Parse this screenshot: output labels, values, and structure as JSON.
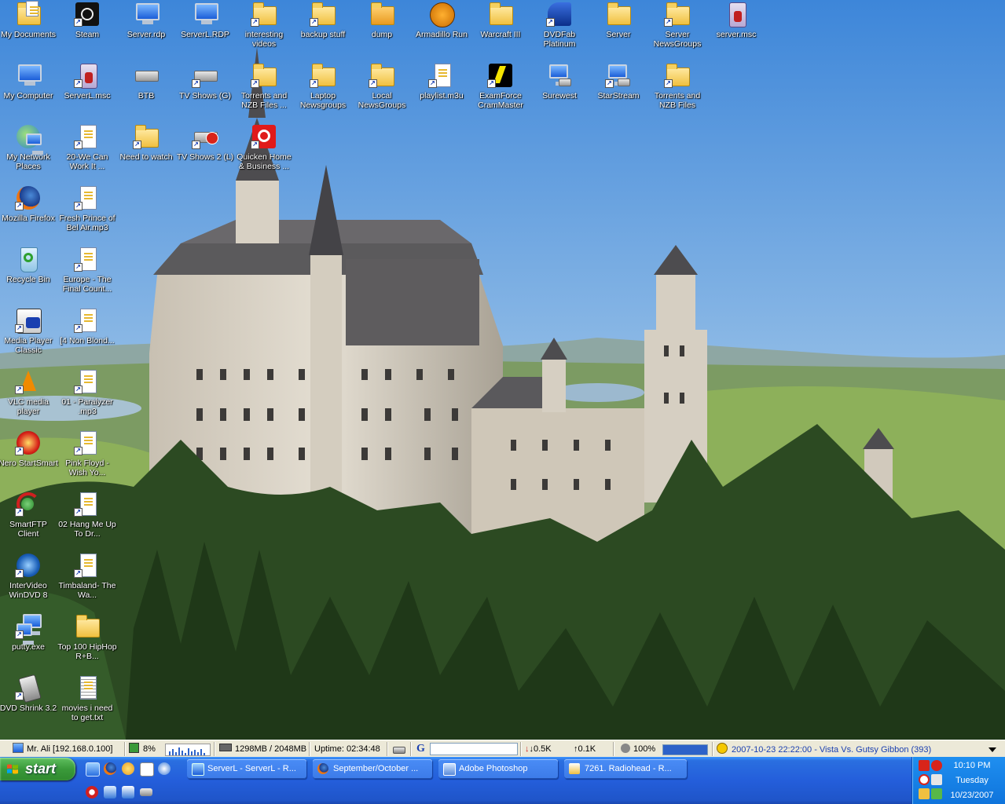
{
  "desktop": {
    "icons": [
      {
        "label": "My Documents",
        "icon": "my-documents-icon"
      },
      {
        "label": "Steam",
        "icon": "steam-icon"
      },
      {
        "label": "Server.rdp",
        "icon": "remote-desktop-icon"
      },
      {
        "label": "ServerL.RDP",
        "icon": "remote-desktop-icon"
      },
      {
        "label": "interesting videos",
        "icon": "folder-icon"
      },
      {
        "label": "backup stuff",
        "icon": "folder-icon"
      },
      {
        "label": "dump",
        "icon": "folder-icon"
      },
      {
        "label": "Armadillo Run",
        "icon": "armadillo-run-icon"
      },
      {
        "label": "Warcraft III",
        "icon": "folder-icon"
      },
      {
        "label": "DVDFab Platinum",
        "icon": "dvdfab-icon"
      },
      {
        "label": "Server",
        "icon": "folder-icon"
      },
      {
        "label": "Server NewsGroups",
        "icon": "folder-icon"
      },
      {
        "label": "server.msc",
        "icon": "msc-console-icon"
      },
      {
        "label": "My Computer",
        "icon": "my-computer-icon"
      },
      {
        "label": "ServerL.msc",
        "icon": "msc-console-icon"
      },
      {
        "label": "BTB",
        "icon": "network-drive-icon"
      },
      {
        "label": "TV Shows (G)",
        "icon": "network-drive-icon"
      },
      {
        "label": "Torrents and NZB Files ...",
        "icon": "folder-icon"
      },
      {
        "label": "Laptop Newsgroups",
        "icon": "folder-icon"
      },
      {
        "label": "Local NewsGroups",
        "icon": "folder-icon"
      },
      {
        "label": "playlist.m3u",
        "icon": "media-file-icon"
      },
      {
        "label": "ExamForce CramMaster",
        "icon": "examforce-icon"
      },
      {
        "label": "Surewest",
        "icon": "network-connection-icon"
      },
      {
        "label": "StarStream",
        "icon": "network-connection-icon"
      },
      {
        "label": "Torrents and NZB Files",
        "icon": "folder-icon"
      },
      {
        "label": "My Network Places",
        "icon": "network-places-icon"
      },
      {
        "label": "20-We Can Work It ...",
        "icon": "media-file-icon"
      },
      {
        "label": "Need to watch",
        "icon": "folder-icon"
      },
      {
        "label": "TV Shows 2 (L)",
        "icon": "disconnected-drive-icon"
      },
      {
        "label": "Quicken Home & Business ...",
        "icon": "quicken-icon"
      },
      {
        "label": "Mozilla Firefox",
        "icon": "firefox-icon"
      },
      {
        "label": "Fresh Prince of Bel Air.mp3",
        "icon": "media-file-icon"
      },
      {
        "label": "Recycle Bin",
        "icon": "recycle-bin-icon"
      },
      {
        "label": "Europe - The Final Count...",
        "icon": "media-file-icon"
      },
      {
        "label": "Media Player Classic",
        "icon": "media-player-classic-icon"
      },
      {
        "label": "[4 Non Blond...",
        "icon": "media-file-icon"
      },
      {
        "label": "VLC media player",
        "icon": "vlc-icon"
      },
      {
        "label": "01 - Paralyzer .mp3",
        "icon": "media-file-icon"
      },
      {
        "label": "Nero StartSmart",
        "icon": "nero-icon"
      },
      {
        "label": "Pink Floyd - Wish Yo...",
        "icon": "media-file-icon"
      },
      {
        "label": "SmartFTP Client",
        "icon": "smartftp-icon"
      },
      {
        "label": "02 Hang Me Up To Dr...",
        "icon": "media-file-icon"
      },
      {
        "label": "InterVideo WinDVD 8",
        "icon": "windvd-icon"
      },
      {
        "label": "Timbaland- The Wa...",
        "icon": "media-file-icon"
      },
      {
        "label": "putty.exe",
        "icon": "putty-icon"
      },
      {
        "label": "Top 100 HipHop R+B...",
        "icon": "folder-icon"
      },
      {
        "label": "DVD Shrink 3.2",
        "icon": "dvd-shrink-icon"
      },
      {
        "label": "movies i need to get.txt",
        "icon": "text-file-icon"
      }
    ]
  },
  "statusbar": {
    "host": "Mr. Ali [192.168.0.100]",
    "cpu": "8%",
    "memory": "1298MB / 2048MB",
    "uptime": "Uptime: 02:34:48",
    "search_letter": "G",
    "down": "0.5K",
    "up": "0.1K",
    "volume": "100%",
    "volume_level": 1.0,
    "news": "2007-10-23 22:22:00 - Vista Vs. Gutsy Gibbon (393)"
  },
  "taskbar": {
    "start_label": "start",
    "tasks": [
      {
        "label": "ServerL - ServerL - R...",
        "icon": "remote-desktop-icon"
      },
      {
        "label": "September/October ...",
        "icon": "firefox-icon"
      },
      {
        "label": "Adobe Photoshop",
        "icon": "photoshop-icon"
      },
      {
        "label": "7261. Radiohead - R...",
        "icon": "media-file-icon"
      }
    ],
    "clock": {
      "time": "10:10 PM",
      "day": "Tuesday",
      "date": "10/23/2007"
    }
  },
  "colors": {
    "taskbar": "#245edb",
    "start": "#3a9a3a",
    "bar": "#ece9d8",
    "news_link": "#1a3fb0"
  }
}
